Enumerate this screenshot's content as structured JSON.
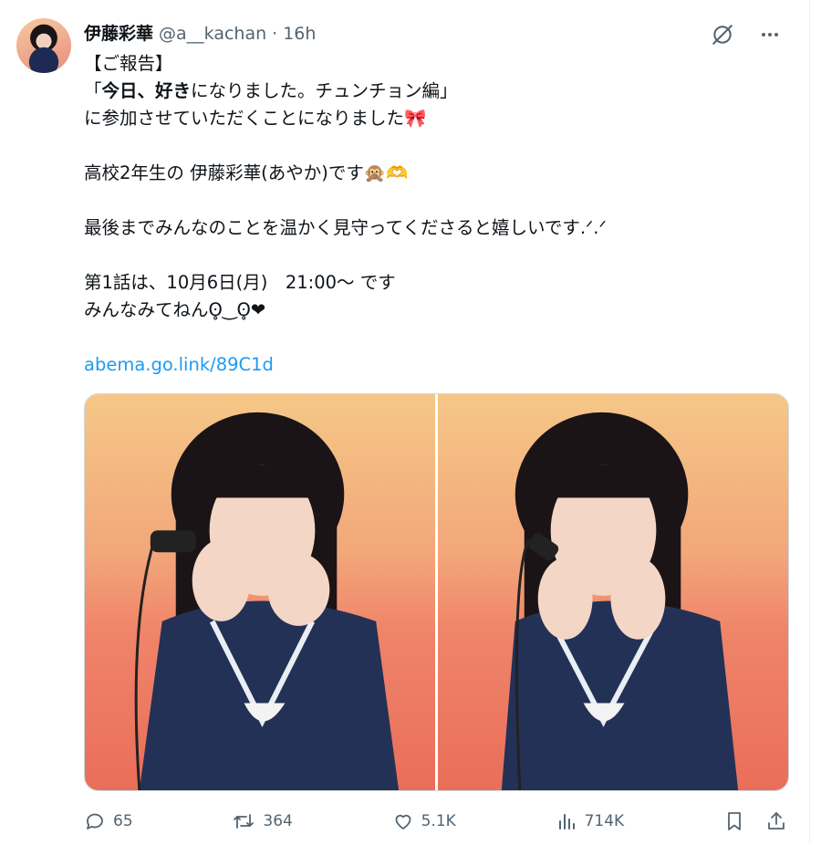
{
  "post": {
    "author_name": "伊藤彩華",
    "handle": "@a__kachan",
    "separator": "·",
    "time": "16h",
    "lines": [
      "【ご報告】",
      "「今日、好きになりました。チュンチョン編」",
      "に参加させていただくことになりました🎀",
      "",
      "高校2年生の 伊藤彩華(あやか)です🙊🫶",
      "",
      "最後までみんなのことを温かく見守ってくださると嬉しいです.ᐟ.ᐟ",
      "",
      "第1話は、10月6日(月)　21:00〜 です",
      "みんなみてねんʘ̥‿ʘ̥❤︎",
      "",
      "abema.go.link/89C1d"
    ],
    "line2_parts": {
      "open": "「",
      "bold1": "今日、",
      "bold2": "好き",
      "rest": "になりました。チュンチョン編」"
    },
    "line3_text": "に参加させていただくことになりました",
    "line3_emoji": "🎀",
    "line5_text": "高校2年生の 伊藤彩華(あやか)です",
    "line5_emoji": "🙊🫶"
  },
  "media": {
    "images": [
      "photo-left",
      "photo-right"
    ]
  },
  "actions": {
    "replies": "65",
    "reposts": "364",
    "likes": "5.1K",
    "views": "714K"
  },
  "icons": {
    "top": [
      "grok-icon",
      "more-icon"
    ],
    "bottom": [
      "reply-icon",
      "repost-icon",
      "like-icon",
      "views-icon",
      "bookmark-icon",
      "share-icon"
    ]
  },
  "colors": {
    "link": "#1d9bf0",
    "secondary": "#536471",
    "text": "#0f1419"
  }
}
